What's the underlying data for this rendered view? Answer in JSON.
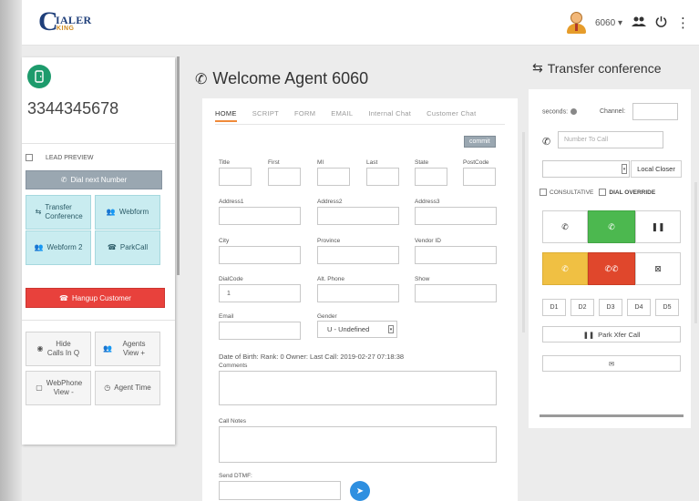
{
  "app": {
    "logo_top": "IALER",
    "logo_bottom": "KING"
  },
  "header": {
    "agent_id": "6060"
  },
  "left": {
    "phone_number": "3344345678",
    "lead_preview_label": "LEAD PREVIEW",
    "dial_next_label": "Dial next Number",
    "transfer_conference_label": "Transfer Conference",
    "webform_label": "Webform",
    "webform2_label": "Webform 2",
    "parkcall_label": "ParkCall",
    "hangup_label": "Hangup Customer",
    "hide_calls_label": "Hide Calls In Q",
    "agents_view_label": "Agents View +",
    "webphone_label": "WebPhone View -",
    "agent_time_label": "Agent Time"
  },
  "main": {
    "welcome": "Welcome Agent 6060",
    "tabs": [
      "HOME",
      "SCRIPT",
      "FORM",
      "EMAIL",
      "Internal Chat",
      "Customer Chat"
    ],
    "commit_label": "commit",
    "fields": {
      "title": "Title",
      "first": "First",
      "mi": "MI",
      "last": "Last",
      "state": "State",
      "postcode": "PostCode",
      "address1": "Address1",
      "address2": "Address2",
      "address3": "Address3",
      "city": "City",
      "province": "Province",
      "vendor_id": "Vendor ID",
      "dialcode": "DialCode",
      "dialcode_value": "1",
      "alt_phone": "Alt. Phone",
      "show": "Show",
      "email": "Email",
      "gender": "Gender",
      "gender_value": "U - Undefined",
      "comments": "Comments",
      "call_notes": "Call Notes",
      "send_dtmf": "Send DTMF:"
    },
    "dob_line": "Date of Birth:   Rank: 0  Owner:   Last Call: 2019-02-27 07:18:38"
  },
  "transfer": {
    "title": "Transfer conference",
    "seconds_label": "seconds:",
    "channel_label": "Channel:",
    "number_placeholder": "Number To Call",
    "local_closer_label": "Local Closer",
    "consultative_label": "CONSULTATIVE",
    "dial_override_label": "DIAL OVERRIDE",
    "d_buttons": [
      "D1",
      "D2",
      "D3",
      "D4",
      "D5"
    ],
    "park_xfer_label": "Park Xfer Call"
  },
  "colors": {
    "green": "#4cb84f",
    "yellow": "#f0c043",
    "red": "#e0472c",
    "teal": "#c9ecf0",
    "hangup": "#e8413c"
  }
}
